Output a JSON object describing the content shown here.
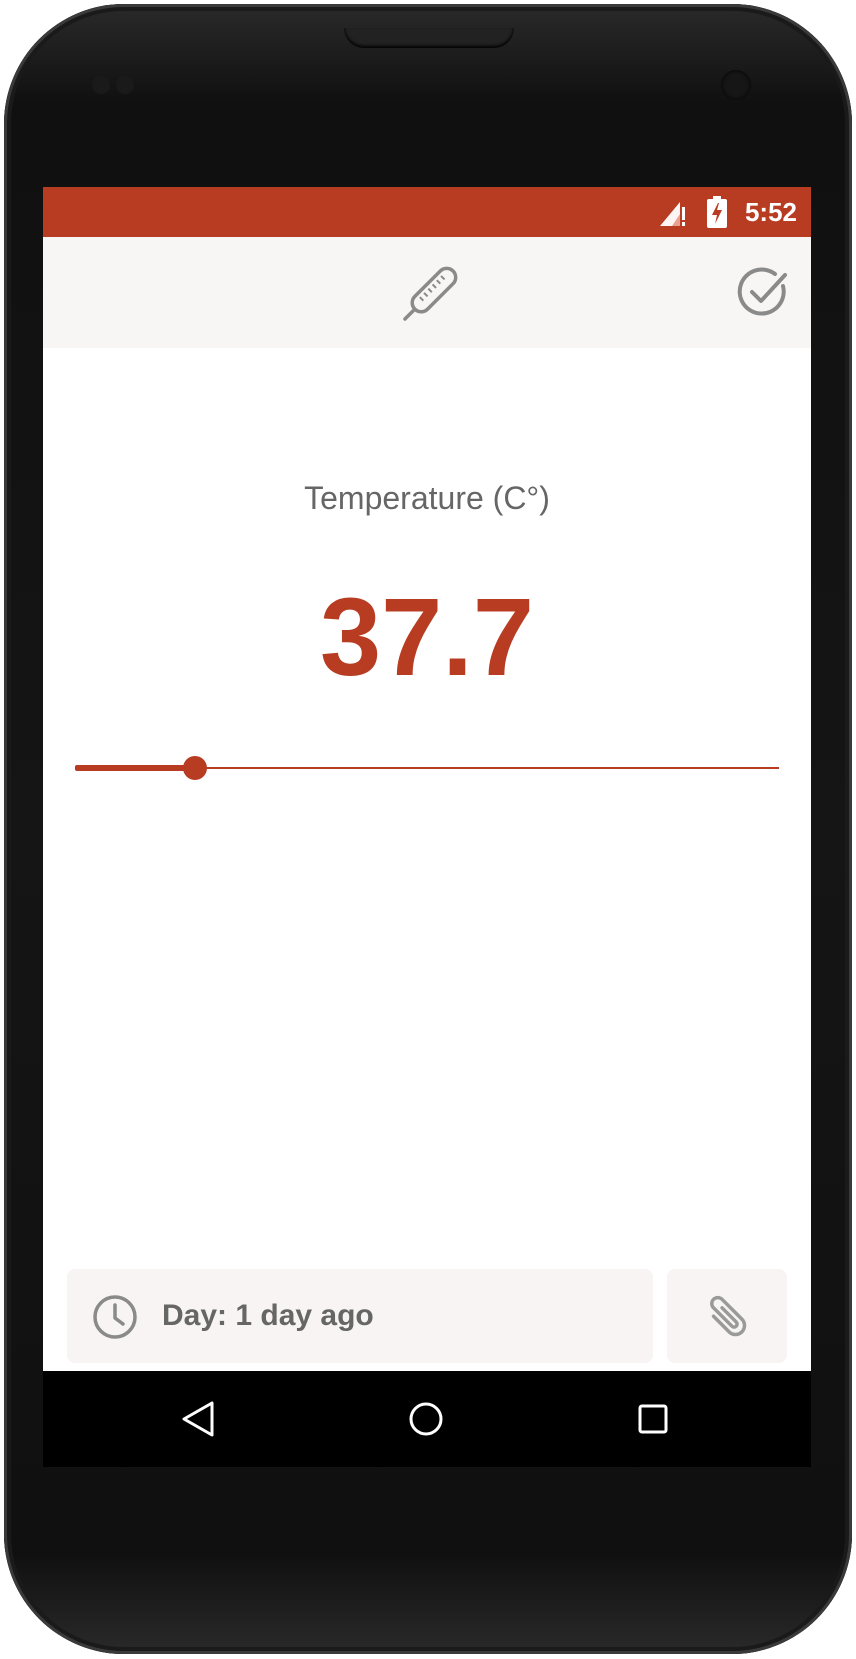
{
  "status_bar": {
    "time": "5:52",
    "background_color": "#b83c22",
    "icons": [
      "signal-alert-icon",
      "battery-charging-icon"
    ]
  },
  "toolbar": {
    "background_color": "#f7f6f5",
    "icons": [
      "thermometer-icon",
      "done-check-icon"
    ]
  },
  "measurement": {
    "label": "Temperature (C°)",
    "value": "37.7",
    "accent_color": "#b83c22",
    "slider_fraction": 0.17
  },
  "footer": {
    "day_label": "Day: 1 day ago",
    "day_icon": "clock-icon",
    "attach_icon": "paperclip-icon"
  },
  "navigation": {
    "icons": [
      "back-icon",
      "home-icon",
      "recents-icon"
    ]
  }
}
